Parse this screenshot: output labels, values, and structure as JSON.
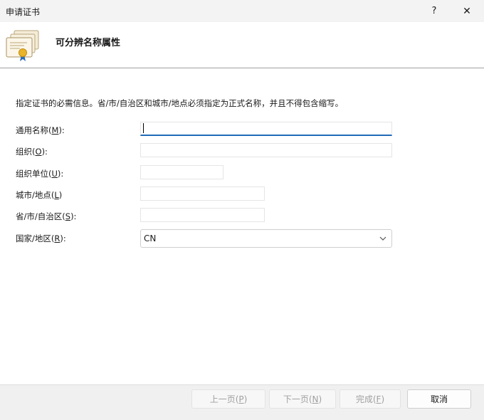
{
  "window": {
    "title": "申请证书",
    "help_glyph": "?",
    "close_glyph": "✕"
  },
  "header": {
    "title": "可分辨名称属性",
    "icon": "certificate-icon"
  },
  "instruction": "指定证书的必需信息。省/市/自治区和城市/地点必须指定为正式名称，并且不得包含缩写。",
  "fields": {
    "common_name": {
      "label": "通用名称(",
      "accel": "M",
      "suffix": "):",
      "value": ""
    },
    "organization": {
      "label": "组织(",
      "accel": "O",
      "suffix": "):",
      "value": ""
    },
    "org_unit": {
      "label": "组织单位(",
      "accel": "U",
      "suffix": "):",
      "value": ""
    },
    "city": {
      "label": "城市/地点(",
      "accel": "L",
      "suffix": ")",
      "value": ""
    },
    "state": {
      "label": "省/市/自治区(",
      "accel": "S",
      "suffix": "):",
      "value": ""
    },
    "country": {
      "label": "国家/地区(",
      "accel": "R",
      "suffix": "):",
      "value": "CN"
    }
  },
  "buttons": {
    "prev": {
      "label": "上一页(",
      "accel": "P",
      "suffix": ")",
      "enabled": false
    },
    "next": {
      "label": "下一页(",
      "accel": "N",
      "suffix": ")",
      "enabled": false
    },
    "finish": {
      "label": "完成(",
      "accel": "F",
      "suffix": ")",
      "enabled": false
    },
    "cancel": {
      "label": "取消",
      "enabled": true
    }
  },
  "colors": {
    "focus_accent": "#1f6ab7",
    "disabled_text": "#a0a0a0"
  }
}
